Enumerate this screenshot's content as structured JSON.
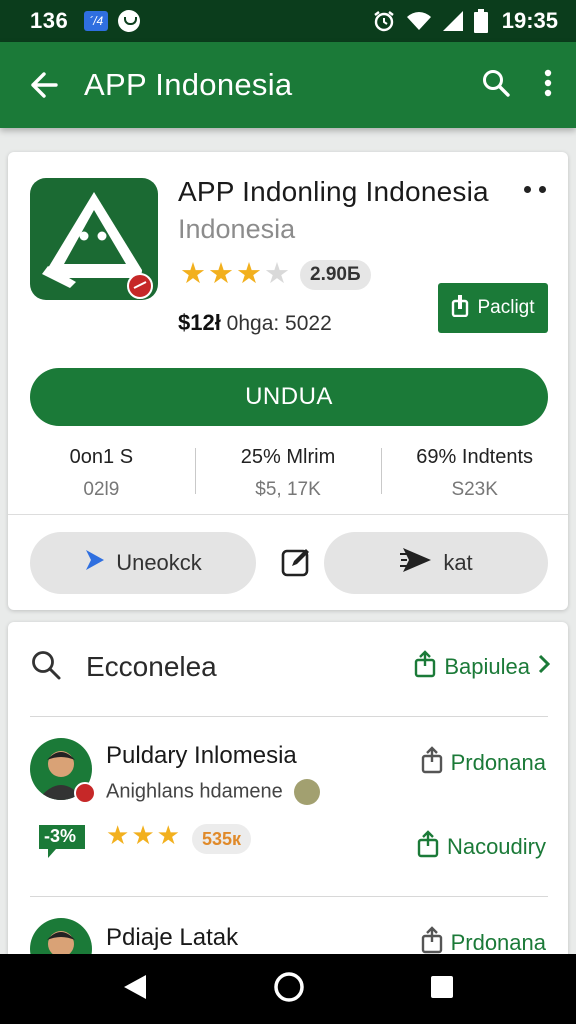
{
  "status_bar": {
    "left_time": "136",
    "badge": "´/4",
    "clock": "19:35"
  },
  "app_bar": {
    "title": "APP Indonesia"
  },
  "app": {
    "name": "APP Indonling Indonesia",
    "developer": "Indonesia",
    "rating_count": "2.90Б",
    "price": "$12ł",
    "price_meta": "0hga:  5022",
    "package_button": "Pacligt",
    "install_button": "UNDUA",
    "stars_filled": 3,
    "stats": [
      {
        "top": "0on1 S",
        "bottom": "02l9"
      },
      {
        "top": "25%  Mlrim",
        "bottom": "$5, 17K"
      },
      {
        "top": "69% Indtents",
        "bottom": "S23K"
      }
    ],
    "chip_left": "Uneokck",
    "chip_right": "kat"
  },
  "related": {
    "header_label": "Ecconelea",
    "header_link": "Bapiulea",
    "items": [
      {
        "name": "Puldary Inlomesia",
        "sub": "Anighlans hdamene",
        "action": "Prdonana",
        "chat_label": "-3%",
        "pill": "535к",
        "second_action": "Nacoudiry"
      },
      {
        "name": "Pdiaje Latak",
        "action": "Prdonana"
      }
    ]
  },
  "colors": {
    "primary": "#1b7a38",
    "status_bar": "#0b3d1c",
    "star": "#f2b01e"
  }
}
